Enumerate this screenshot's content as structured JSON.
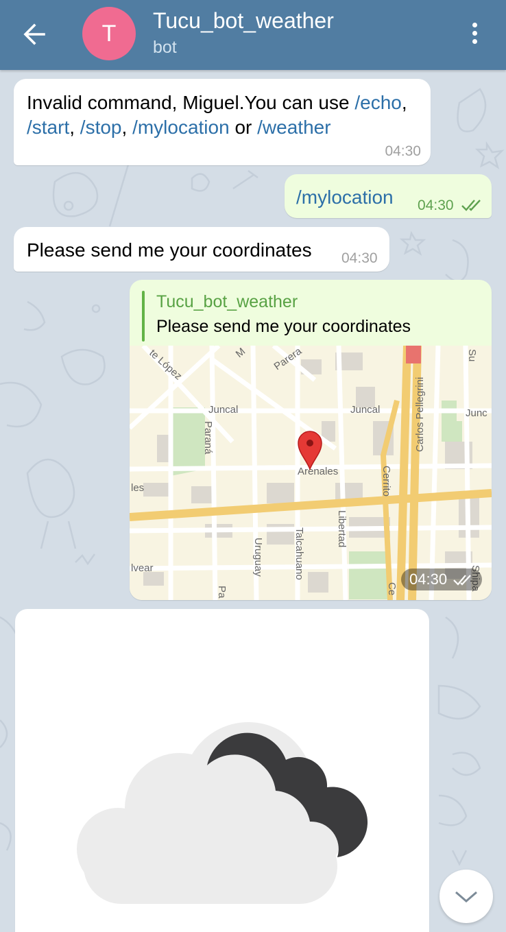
{
  "header": {
    "avatar_letter": "T",
    "title": "Tucu_bot_weather",
    "subtitle": "bot",
    "back_icon": "arrow-left-icon",
    "menu_icon": "more-vertical-icon"
  },
  "colors": {
    "header": "#517da2",
    "avatar": "#f06b91",
    "outgoing_bubble": "#effdde",
    "link": "#2c6fa8",
    "reply_accent": "#62b346",
    "chat_background": "#d4dde6"
  },
  "messages": {
    "m1": {
      "prefix": "Invalid command, Miguel.You can use ",
      "cmd_echo": "/echo",
      "sep1": ", ",
      "cmd_start": "/start",
      "sep2": ", ",
      "cmd_stop": "/stop",
      "sep3": ", ",
      "cmd_mylocation": "/mylocation",
      "sep4": " or ",
      "cmd_weather": "/weather",
      "time": "04:30"
    },
    "m2": {
      "text": "/mylocation",
      "time": "04:30",
      "status_icon": "double-check-icon"
    },
    "m3": {
      "text": "Please send me your coordinates",
      "time": "04:30"
    },
    "m4": {
      "reply_name": "Tucu_bot_weather",
      "reply_text": "Please send me your coordinates",
      "time": "04:30",
      "status_icon": "double-check-icon",
      "map_labels": {
        "lopez": "te López",
        "m": "M",
        "parera": "Parera",
        "juncal_left": "Juncal",
        "juncal_right": "Juncal",
        "junc": "Junc",
        "parana": "Paraná",
        "arenales": "Arenales",
        "les": "les",
        "cerrito": "Cerrito",
        "pellegrini": "Carlos Pellegrini",
        "libertad": "Libertad",
        "uruguay": "Uruguay",
        "talcahuano": "Talcahuano",
        "lvear": "lvear",
        "pa": "Pa",
        "ce": "Ce",
        "sh": "Shipa",
        "sr": "Su"
      }
    },
    "m5": {
      "image_icon": "cloudy-night-weather-icon"
    }
  },
  "scroll_down_icon": "chevron-down-icon"
}
